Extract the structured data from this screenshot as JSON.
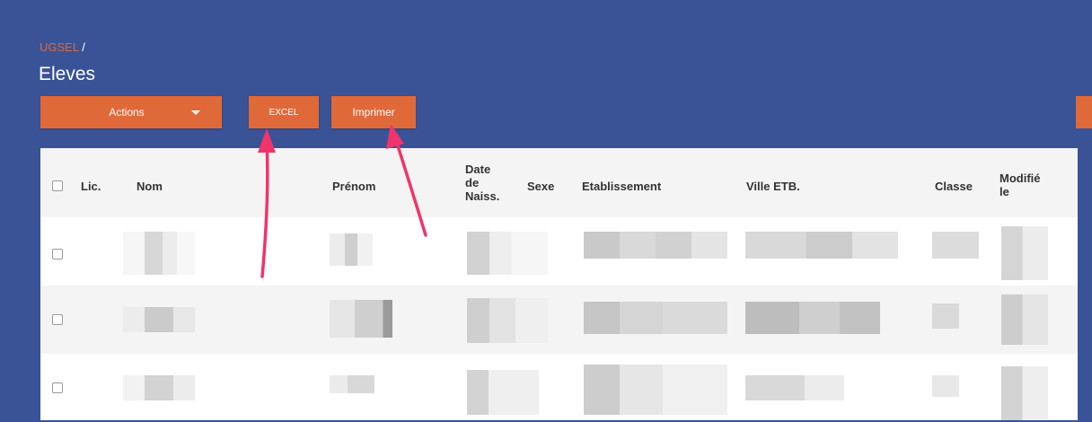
{
  "breadcrumb": {
    "root": "UGSEL",
    "separator": " /"
  },
  "page_title": "Eleves",
  "toolbar": {
    "actions_label": "Actions",
    "excel_label": "EXCEL",
    "print_label": "Imprimer"
  },
  "table": {
    "headers": {
      "lic": "Lic.",
      "nom": "Nom",
      "prenom": "Prénom",
      "date_line1": "Date",
      "date_line2": "de",
      "date_line3": "Naiss.",
      "sexe": "Sexe",
      "etablissement": "Etablissement",
      "ville": "Ville ETB.",
      "classe": "Classe",
      "modifie_line1": "Modifié",
      "modifie_line2": "le"
    }
  },
  "colors": {
    "background": "#3a5396",
    "accent": "#e0693a",
    "arrow": "#f0346a"
  }
}
